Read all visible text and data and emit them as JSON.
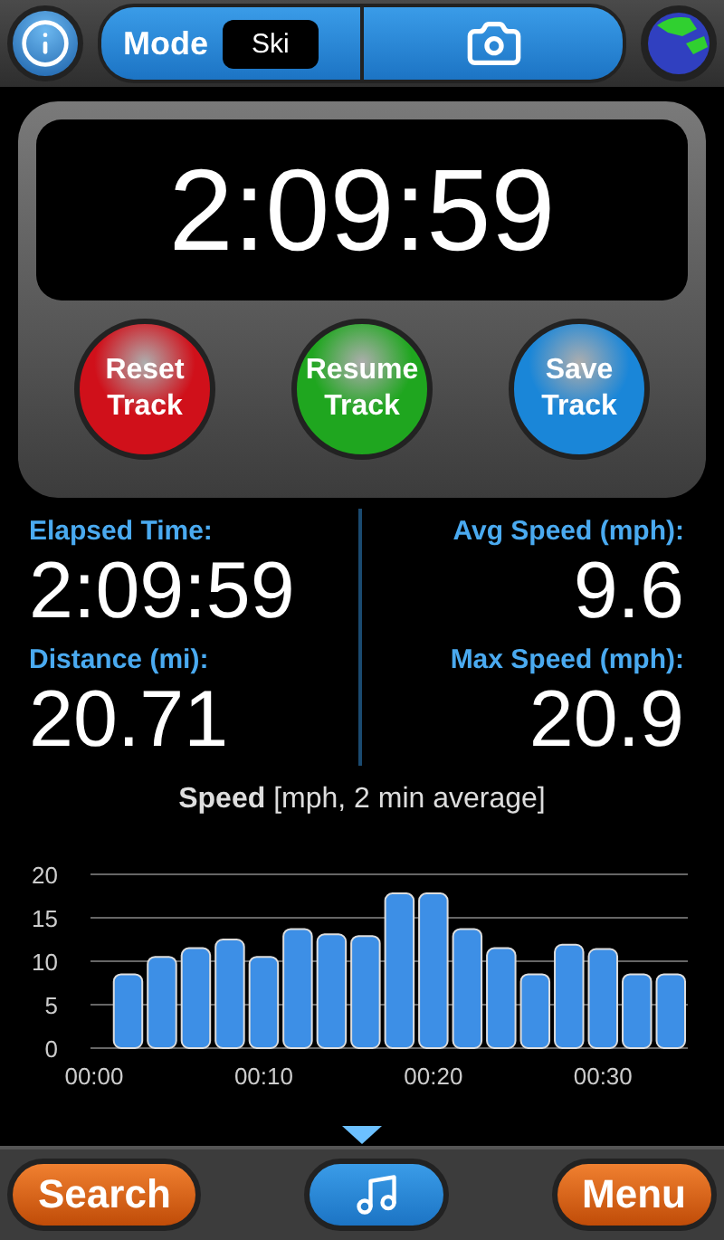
{
  "top_bar": {
    "mode_label": "Mode",
    "mode_value": "Ski"
  },
  "timer": {
    "display": "2:09:59",
    "buttons": [
      {
        "label": "Reset Track",
        "color": "#d0101a"
      },
      {
        "label": "Resume Track",
        "color": "#1fa61f"
      },
      {
        "label": "Save Track",
        "color": "#1a86d8"
      }
    ]
  },
  "stats": [
    {
      "label": "Elapsed Time:",
      "value": "2:09:59"
    },
    {
      "label": "Avg Speed (mph):",
      "value": "9.6"
    },
    {
      "label": "Distance (mi):",
      "value": "20.71"
    },
    {
      "label": "Max Speed (mph):",
      "value": "20.9"
    }
  ],
  "chart": {
    "chart_data": {
      "type": "bar",
      "title": "**Speed** [mph, 2 min average]",
      "x": [
        2,
        4,
        6,
        8,
        10,
        12,
        14,
        16,
        18,
        20,
        22,
        24,
        26,
        28,
        30,
        32,
        34
      ],
      "xlim": [
        0,
        35
      ],
      "values": [
        8.5,
        10.5,
        11.5,
        12.5,
        10.5,
        13.7,
        13.1,
        12.9,
        17.8,
        17.8,
        13.7,
        11.5,
        8.5,
        11.9,
        11.4,
        8.5,
        8.5
      ],
      "ylim": [
        0,
        20
      ],
      "grid": true,
      "yticks": [
        0,
        5,
        10,
        15,
        20
      ],
      "xticks": [
        {
          "value": 0,
          "label": "00:00"
        },
        {
          "value": 10,
          "label": "00:10"
        },
        {
          "value": 20,
          "label": "00:20"
        },
        {
          "value": 30,
          "label": "00:30"
        }
      ]
    }
  },
  "bottom_bar": {
    "left_button": "Search",
    "right_button": "Menu"
  }
}
